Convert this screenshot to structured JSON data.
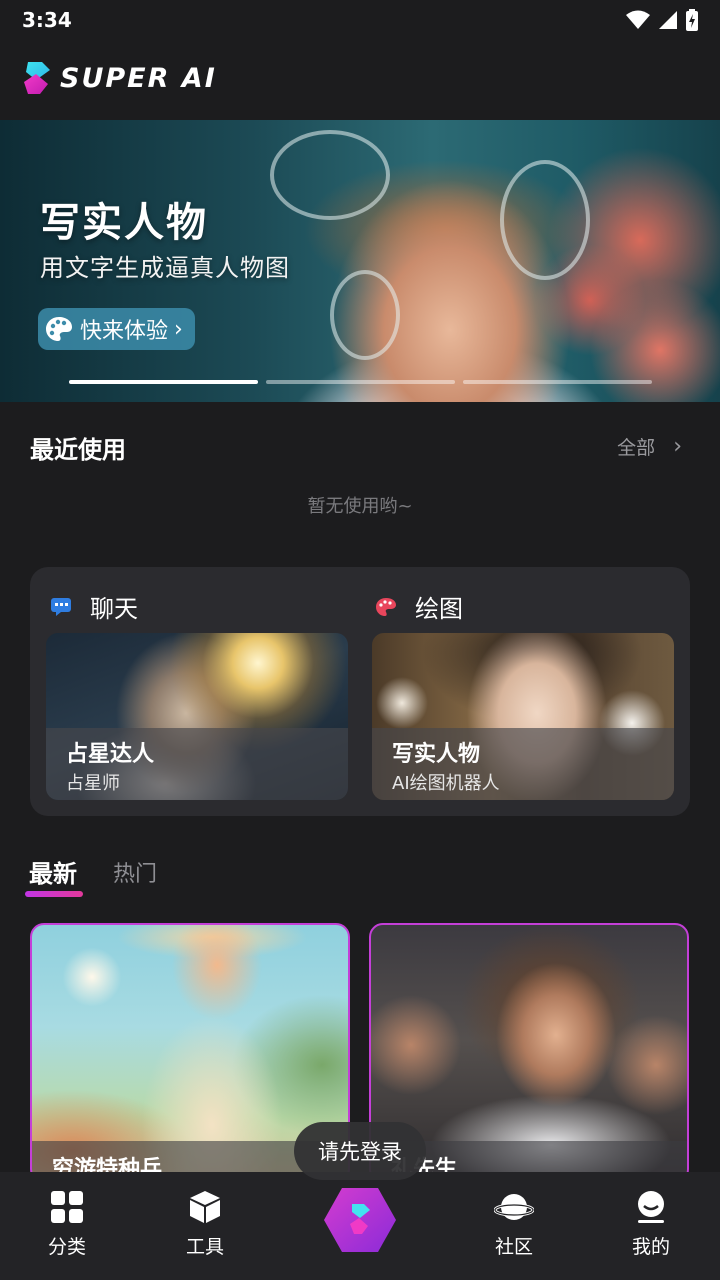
{
  "status_bar": {
    "time": "3:34"
  },
  "header": {
    "brand": "SUPER AI"
  },
  "banner": {
    "title": "写实人物",
    "subtitle": "用文字生成逼真人物图",
    "cta_label": "快来体验",
    "slide_count": 3,
    "active_slide": 1
  },
  "recent": {
    "title": "最近使用",
    "all_label": "全部",
    "empty_text": "暂无使用哟~"
  },
  "features": {
    "chat": {
      "label": "聊天",
      "card": {
        "name": "占星达人",
        "desc": "占星师"
      }
    },
    "draw": {
      "label": "绘图",
      "card": {
        "name": "写实人物",
        "desc": "AI绘图机器人"
      }
    }
  },
  "tabs": {
    "latest": "最新",
    "hot": "热门",
    "active": "最新"
  },
  "feed": [
    {
      "caption": "穷游特种兵"
    },
    {
      "caption": "礼先生"
    }
  ],
  "toast": "请先登录",
  "bottom_nav": {
    "category": "分类",
    "tools": "工具",
    "community": "社区",
    "mine": "我的"
  },
  "colors": {
    "accent": "#c235e6",
    "accent_pink": "#e2399b",
    "background": "#1c1c1e",
    "panel": "#2b2b2f"
  }
}
